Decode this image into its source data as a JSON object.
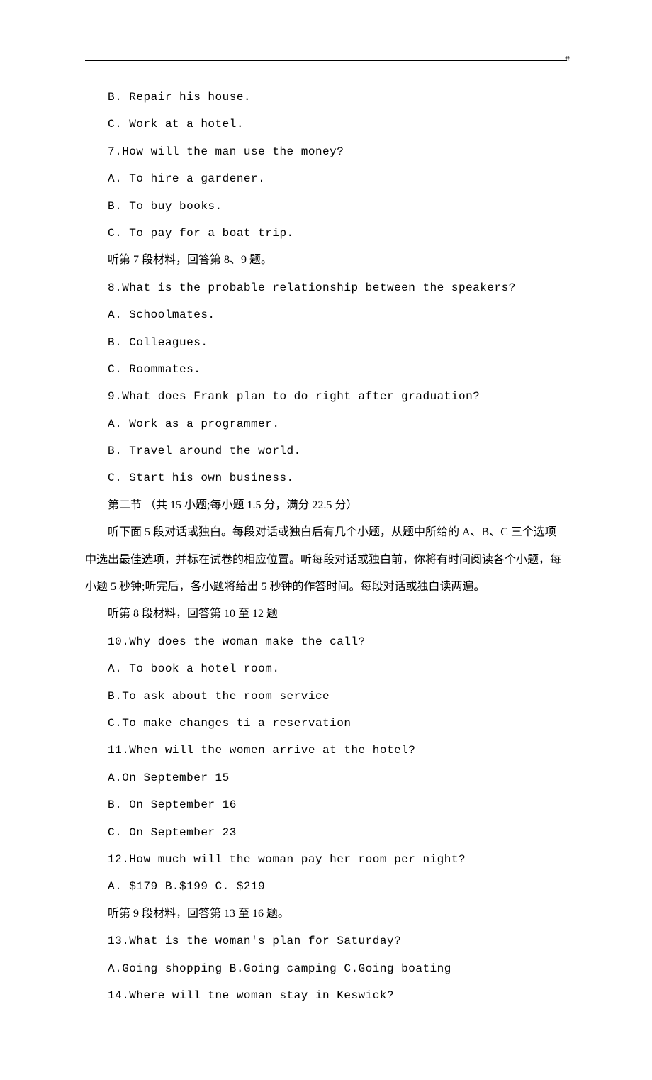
{
  "header_mark": "-#",
  "lines": {
    "l01": "B. Repair his house.",
    "l02": "C. Work at a hotel.",
    "l03": "7.How will the man use the money?",
    "l04": "A. To hire a gardener.",
    "l05": "B. To buy books.",
    "l06": "C. To pay for a boat trip.",
    "l07": "听第 7 段材料，回答第 8、9 题。",
    "l08": "8.What is the probable relationship between the speakers?",
    "l09": "A. Schoolmates.",
    "l10": "B. Colleagues.",
    "l11": "C. Roommates.",
    "l12": "9.What does Frank plan to do right after graduation?",
    "l13": "A. Work as a programmer.",
    "l14": "B. Travel around the world.",
    "l15": "C. Start his own business.",
    "l16": "第二节  （共 15 小题;每小题 1.5 分，满分 22.5 分）",
    "l17": "听下面 5 段对话或独白。每段对话或独白后有几个小题，从题中所给的 A、B、C 三个选项中选出最佳选项，并标在试卷的相应位置。听每段对话或独白前，你将有时间阅读各个小题，每小题 5 秒钟;听完后，各小题将给出 5 秒钟的作答时间。每段对话或独白读两遍。",
    "l18": "听第 8 段材料，回答第 10 至 12 题",
    "l19": "10.Why does the woman make the call?",
    "l20": "A. To book a hotel room.",
    "l21": "B.To ask about the room service",
    "l22": "C.To make changes ti a reservation",
    "l23": "11.When will the women arrive at the hotel?",
    "l24": "A.On September 15",
    "l25": "B. On September 16",
    "l26": "C. On September 23",
    "l27": "12.How much will the woman pay her room per night?",
    "l28": "A. $179 B.$199 C. $219",
    "l29": "听第 9 段材料，回答第 13 至 16 题。",
    "l30": "13.What is the woman's plan for Saturday?",
    "l31": "A.Going shopping B.Going camping C.Going boating",
    "l32": "14.Where will tne woman stay in Keswick?"
  }
}
